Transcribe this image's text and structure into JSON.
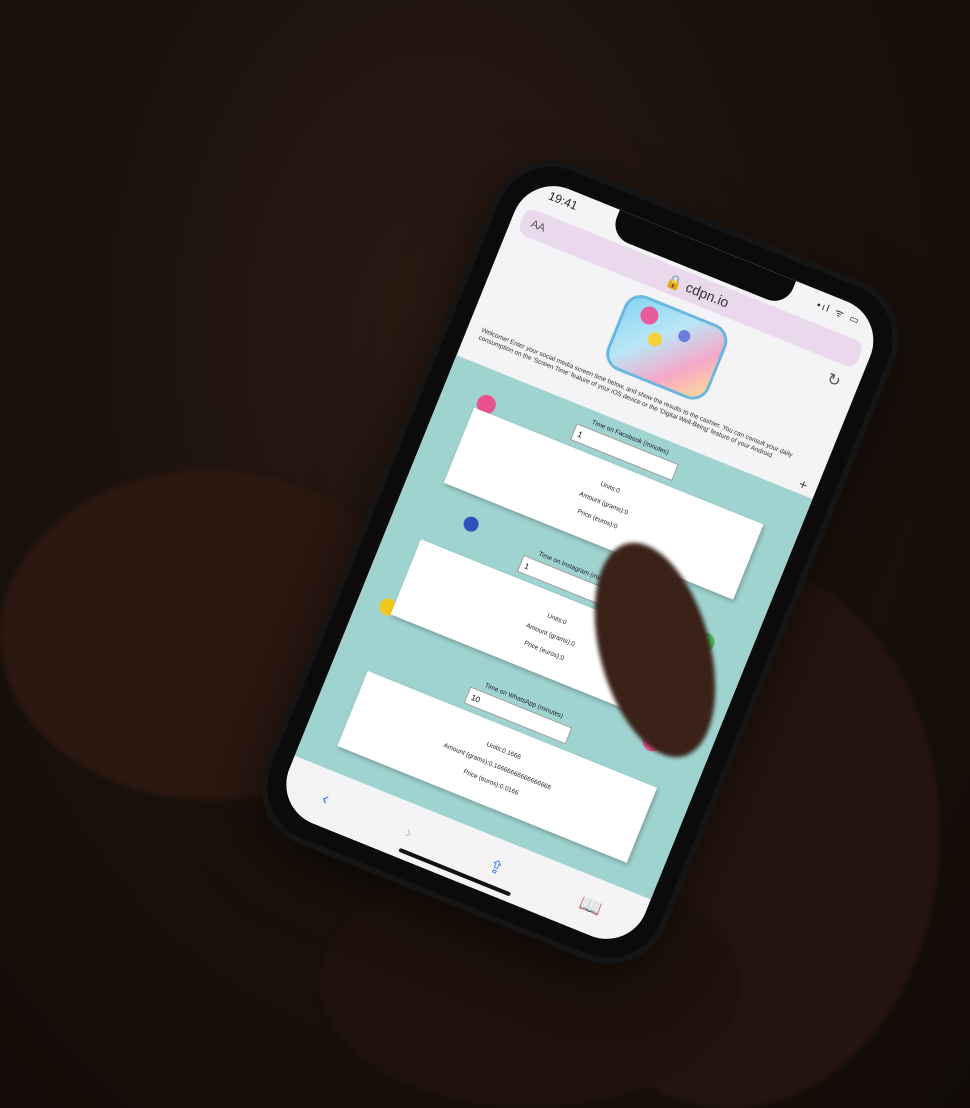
{
  "status": {
    "time": "19:41",
    "signal": "•ıl ᯤ ▭"
  },
  "browser": {
    "text_size_label": "AA",
    "url": "🔒 cdpn.io",
    "reload_icon": "reload-icon"
  },
  "page": {
    "intro": "Welcome! Enter your social media screen time below, and show the results to the cashier. You can consult your daily consumption on the 'Screen Time' feature of your iOS device or the 'Digital Well-Being' feature of your Android.",
    "plus": "+",
    "sections": [
      {
        "label": "Time on Facebook (minutes)",
        "value": "1",
        "units": "Units:0",
        "amount": "Amount (grams):0",
        "price": "Price (euros):0"
      },
      {
        "label": "Time on Instagram (minutes)",
        "value": "1",
        "units": "Units:0",
        "amount": "Amount (grams):0",
        "price": "Price (euros):0"
      },
      {
        "label": "Time on WhatsApp (minutes)",
        "value": "10",
        "units": "Units:0.1666",
        "amount": "Amount (grams):0.16666666666666666",
        "price": "Price (euros):0.0166"
      }
    ]
  },
  "toolbar": {
    "back": "‹",
    "forward": "›",
    "share": "⇪",
    "bookmarks": "📖"
  }
}
